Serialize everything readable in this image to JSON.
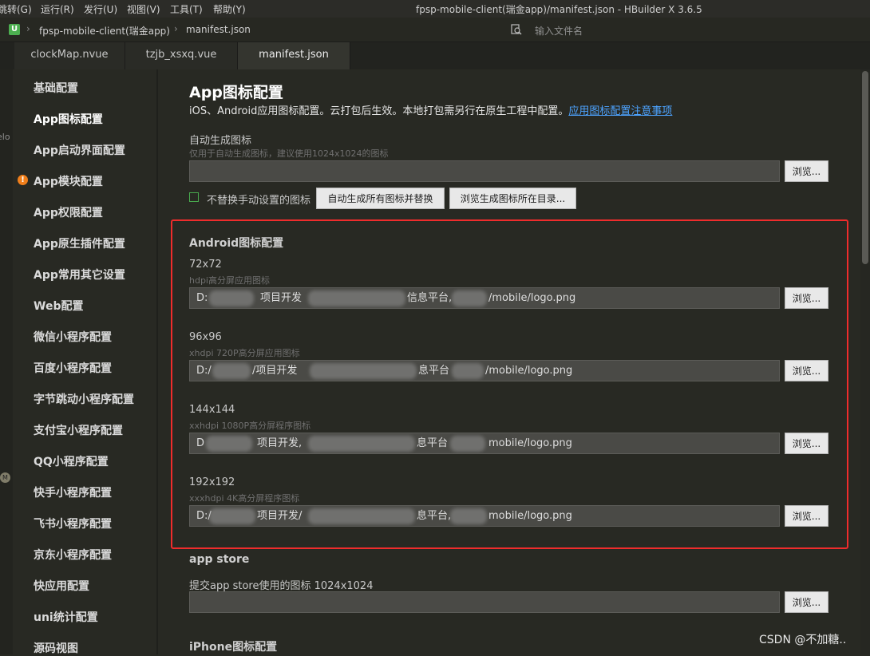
{
  "menu": [
    "跳转(G)",
    "运行(R)",
    "发行(U)",
    "视图(V)",
    "工具(T)",
    "帮助(Y)"
  ],
  "window_title": "fpsp-mobile-client(瑞金app)/manifest.json - HBuilder X 3.6.5",
  "breadcrumb": [
    "fpsp-mobile-client(瑞金app)",
    "manifest.json"
  ],
  "project_icon_letter": "U",
  "file_search_placeholder": "输入文件名",
  "tabs": [
    "clockMap.nvue",
    "tzjb_xsxq.vue",
    "manifest.json"
  ],
  "active_tab": "manifest.json",
  "gutter_text": "elo",
  "gutter_badge": "M",
  "sidebar": [
    "基础配置",
    "App图标配置",
    "App启动界面配置",
    "App模块配置",
    "App权限配置",
    "App原生插件配置",
    "App常用其它设置",
    "Web配置",
    "微信小程序配置",
    "百度小程序配置",
    "字节跳动小程序配置",
    "支付宝小程序配置",
    "QQ小程序配置",
    "快手小程序配置",
    "飞书小程序配置",
    "京东小程序配置",
    "快应用配置",
    "uni统计配置",
    "源码视图"
  ],
  "sidebar_active": "App图标配置",
  "sidebar_warning": "App模块配置",
  "warning_icon_glyph": "!",
  "heading": "App图标配置",
  "description": "iOS、Android应用图标配置。云打包后生效。本地打包需另行在原生工程中配置。",
  "description_link": "应用图标配置注意事项",
  "auto_gen": {
    "label": "自动生成图标",
    "hint": "仅用于自动生成图标，建议使用1024x1024的图标",
    "value": "",
    "checkbox_label": "不替换手动设置的图标",
    "checkbox_checked": false,
    "generate_button": "自动生成所有图标并替换",
    "open_dir_button": "浏览生成图标所在目录..."
  },
  "browse_button": "浏览...",
  "android_title": "Android图标配置",
  "android_icons": [
    {
      "size": "72x72",
      "hint": "hdpi高分屏应用图标",
      "value": [
        "D:",
        "项目开发",
        "信息平台,",
        "/mobile/logo.png"
      ]
    },
    {
      "size": "96x96",
      "hint": "xhdpi 720P高分屏应用图标",
      "value": [
        "D:/",
        "/项目开发",
        "息平台",
        "/mobile/logo.png"
      ]
    },
    {
      "size": "144x144",
      "hint": "xxhdpi 1080P高分屏程序图标",
      "value": [
        "D",
        "项目开发,",
        "息平台",
        "mobile/logo.png"
      ]
    },
    {
      "size": "192x192",
      "hint": "xxxhdpi 4K高分屏程序图标",
      "value": [
        "D:/",
        "项目开发/",
        "息平台,",
        "mobile/logo.png"
      ]
    }
  ],
  "appstore": {
    "title": "app store",
    "label": "提交app store使用的图标 1024x1024",
    "value": ""
  },
  "iphone_title": "iPhone图标配置",
  "watermark": "CSDN @不加糖..",
  "colors": {
    "highlight_box": "#ef2c2c",
    "link": "#4da3ff",
    "warning": "#f07f1b",
    "checkbox": "#48a84d"
  }
}
